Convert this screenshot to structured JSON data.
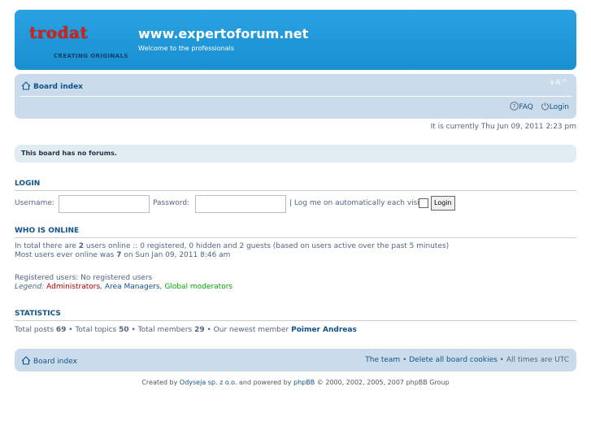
{
  "header": {
    "logo_brand": "trodat",
    "logo_tagline": "CREATING ORIGINALS",
    "site_title": "www.expertoforum.net",
    "site_description": "Welcome to the professionals"
  },
  "nav_top": {
    "board_index": "Board index",
    "font_size": "∨A^",
    "faq": "FAQ",
    "login": "Login"
  },
  "current_time": "It is currently Thu Jun 09, 2011 2:23 pm",
  "no_forums": "This board has no forums.",
  "login": {
    "title": "LOGIN",
    "username_label": "Username:",
    "username_value": "",
    "password_label": "Password:",
    "password_value": "",
    "autologin_label": "| Log me on automatically each visit",
    "button": "Login"
  },
  "who_is_online": {
    "title": "WHO IS ONLINE",
    "line1_a": "In total there are ",
    "line1_count": "2",
    "line1_b": " users online :: 0 registered, 0 hidden and 2 guests (based on users active over the past 5 minutes)",
    "line2_a": "Most users ever online was ",
    "line2_count": "7",
    "line2_b": " on Sun Jan 09, 2011 8:46 am",
    "registered": "Registered users: No registered users",
    "legend_label": "Legend: ",
    "legend_admin": "Administrators",
    "legend_area": "Area Managers",
    "legend_global": "Global moderators",
    "legend_colors": {
      "admin": "#aa0000",
      "area": "#105289",
      "global": "#00aa00"
    }
  },
  "statistics": {
    "title": "STATISTICS",
    "posts_label": "Total posts ",
    "posts": "69",
    "topics_label": " • Total topics ",
    "topics": "50",
    "members_label": " • Total members ",
    "members": "29",
    "newest_label": " • Our newest member ",
    "newest_member": "Poimer Andreas"
  },
  "nav_bottom": {
    "board_index": "Board index",
    "team": "The team",
    "sep1": " • ",
    "delete_cookies": "Delete all board cookies",
    "times": " • All times are UTC"
  },
  "footer": {
    "created_by": "Created by ",
    "odyseja": "Odyseja sp. z o.o.",
    "powered": " and powered by ",
    "phpbb": "phpBB",
    "copyright": " © 2000, 2002, 2005, 2007 phpBB Group"
  },
  "colors": {
    "header_blue": "#1e98d8",
    "navbar": "#cadceb",
    "link": "#105289",
    "logo_red": "#d62017"
  }
}
